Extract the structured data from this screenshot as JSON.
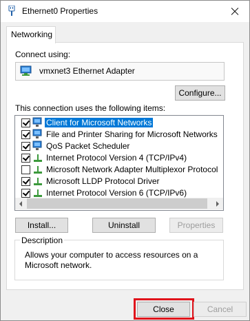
{
  "window": {
    "title": "Ethernet0 Properties"
  },
  "tabs": [
    {
      "label": "Networking"
    }
  ],
  "connect_using": {
    "label": "Connect using:",
    "adapter_name": "vmxnet3 Ethernet Adapter",
    "configure_button": "Configure..."
  },
  "items_section": {
    "label": "This connection uses the following items:",
    "items": [
      {
        "label": "Client for Microsoft Networks",
        "checked": true,
        "selected": true,
        "icon": "network-client-icon"
      },
      {
        "label": "File and Printer Sharing for Microsoft Networks",
        "checked": true,
        "selected": false,
        "icon": "network-service-icon"
      },
      {
        "label": "QoS Packet Scheduler",
        "checked": true,
        "selected": false,
        "icon": "network-service-icon"
      },
      {
        "label": "Internet Protocol Version 4 (TCP/IPv4)",
        "checked": true,
        "selected": false,
        "icon": "protocol-icon"
      },
      {
        "label": "Microsoft Network Adapter Multiplexor Protocol",
        "checked": false,
        "selected": false,
        "icon": "protocol-icon"
      },
      {
        "label": "Microsoft LLDP Protocol Driver",
        "checked": true,
        "selected": false,
        "icon": "protocol-icon"
      },
      {
        "label": "Internet Protocol Version 6 (TCP/IPv6)",
        "checked": true,
        "selected": false,
        "icon": "protocol-icon"
      }
    ]
  },
  "item_buttons": {
    "install": "Install...",
    "uninstall": "Uninstall",
    "properties": "Properties"
  },
  "description": {
    "legend": "Description",
    "text": "Allows your computer to access resources on a Microsoft network."
  },
  "footer": {
    "close": "Close",
    "cancel": "Cancel"
  },
  "colors": {
    "selection": "#0078d7",
    "highlight_border": "#e0131b"
  }
}
